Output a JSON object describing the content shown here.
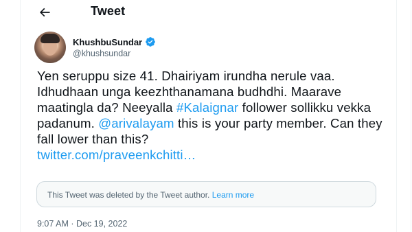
{
  "header": {
    "title": "Tweet"
  },
  "author": {
    "display_name": "KhushbuSundar",
    "handle": "@khushsundar"
  },
  "tweet": {
    "text_1": "Yen seruppu size 41. Dhairiyam irundha nerule vaa. Idhudhaan unga keezhthanamana budhdhi. Maarave maatingla da? Neeyalla ",
    "hashtag": "#Kalaignar",
    "text_2": " follower sollikku vekka padanum. ",
    "mention": "@arivalayam",
    "text_3": " this is your party member. Can they fall lower than this?",
    "link": "twitter.com/praveenkchitti…"
  },
  "deleted_notice": {
    "text": "This Tweet was deleted by the Tweet author.",
    "learn_more": "Learn more"
  },
  "meta": {
    "time": "9:07 AM",
    "separator": " · ",
    "date": "Dec 19, 2022"
  },
  "colors": {
    "accent": "#1d9bf0",
    "text": "#0f1419",
    "secondary": "#536471"
  },
  "icons": {
    "back": "arrow-left-icon",
    "verified": "verified-badge-icon"
  }
}
